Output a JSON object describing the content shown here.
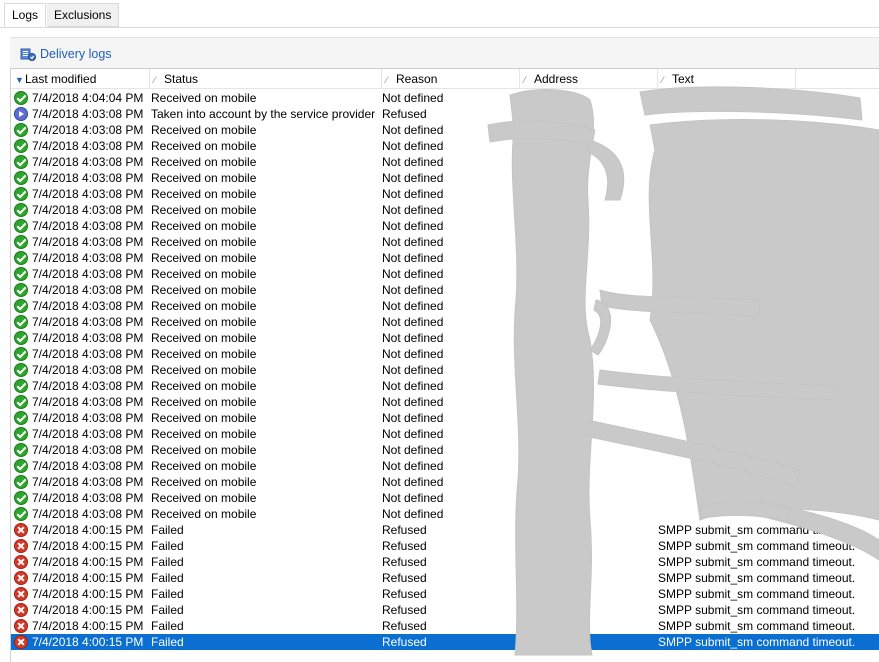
{
  "tabs": [
    {
      "label": "Logs",
      "active": true
    },
    {
      "label": "Exclusions",
      "active": false
    }
  ],
  "toolbar": {
    "link_label": "Delivery logs",
    "link_icon": "delivery-logs-icon"
  },
  "grid": {
    "columns": [
      "Last modified",
      "Status",
      "Reason",
      "Address",
      "Text"
    ],
    "sort_column": "Last modified",
    "sort_direction": "descending",
    "rows": [
      {
        "icon": "ok",
        "date": "7/4/2018 4:04:04 PM",
        "status": "Received on mobile",
        "reason": "Not defined",
        "text": ""
      },
      {
        "icon": "pending",
        "date": "7/4/2018 4:03:08 PM",
        "status": "Taken into account by the service provider",
        "reason": "Refused",
        "text": ""
      },
      {
        "icon": "ok",
        "date": "7/4/2018 4:03:08 PM",
        "status": "Received on mobile",
        "reason": "Not defined",
        "text": ""
      },
      {
        "icon": "ok",
        "date": "7/4/2018 4:03:08 PM",
        "status": "Received on mobile",
        "reason": "Not defined",
        "text": ""
      },
      {
        "icon": "ok",
        "date": "7/4/2018 4:03:08 PM",
        "status": "Received on mobile",
        "reason": "Not defined",
        "text": ""
      },
      {
        "icon": "ok",
        "date": "7/4/2018 4:03:08 PM",
        "status": "Received on mobile",
        "reason": "Not defined",
        "text": ""
      },
      {
        "icon": "ok",
        "date": "7/4/2018 4:03:08 PM",
        "status": "Received on mobile",
        "reason": "Not defined",
        "text": ""
      },
      {
        "icon": "ok",
        "date": "7/4/2018 4:03:08 PM",
        "status": "Received on mobile",
        "reason": "Not defined",
        "text": ""
      },
      {
        "icon": "ok",
        "date": "7/4/2018 4:03:08 PM",
        "status": "Received on mobile",
        "reason": "Not defined",
        "text": ""
      },
      {
        "icon": "ok",
        "date": "7/4/2018 4:03:08 PM",
        "status": "Received on mobile",
        "reason": "Not defined",
        "text": ""
      },
      {
        "icon": "ok",
        "date": "7/4/2018 4:03:08 PM",
        "status": "Received on mobile",
        "reason": "Not defined",
        "text": ""
      },
      {
        "icon": "ok",
        "date": "7/4/2018 4:03:08 PM",
        "status": "Received on mobile",
        "reason": "Not defined",
        "text": ""
      },
      {
        "icon": "ok",
        "date": "7/4/2018 4:03:08 PM",
        "status": "Received on mobile",
        "reason": "Not defined",
        "text": ""
      },
      {
        "icon": "ok",
        "date": "7/4/2018 4:03:08 PM",
        "status": "Received on mobile",
        "reason": "Not defined",
        "text": ""
      },
      {
        "icon": "ok",
        "date": "7/4/2018 4:03:08 PM",
        "status": "Received on mobile",
        "reason": "Not defined",
        "text": ""
      },
      {
        "icon": "ok",
        "date": "7/4/2018 4:03:08 PM",
        "status": "Received on mobile",
        "reason": "Not defined",
        "text": ""
      },
      {
        "icon": "ok",
        "date": "7/4/2018 4:03:08 PM",
        "status": "Received on mobile",
        "reason": "Not defined",
        "text": ""
      },
      {
        "icon": "ok",
        "date": "7/4/2018 4:03:08 PM",
        "status": "Received on mobile",
        "reason": "Not defined",
        "text": ""
      },
      {
        "icon": "ok",
        "date": "7/4/2018 4:03:08 PM",
        "status": "Received on mobile",
        "reason": "Not defined",
        "text": ""
      },
      {
        "icon": "ok",
        "date": "7/4/2018 4:03:08 PM",
        "status": "Received on mobile",
        "reason": "Not defined",
        "text": ""
      },
      {
        "icon": "ok",
        "date": "7/4/2018 4:03:08 PM",
        "status": "Received on mobile",
        "reason": "Not defined",
        "text": ""
      },
      {
        "icon": "ok",
        "date": "7/4/2018 4:03:08 PM",
        "status": "Received on mobile",
        "reason": "Not defined",
        "text": ""
      },
      {
        "icon": "ok",
        "date": "7/4/2018 4:03:08 PM",
        "status": "Received on mobile",
        "reason": "Not defined",
        "text": ""
      },
      {
        "icon": "ok",
        "date": "7/4/2018 4:03:08 PM",
        "status": "Received on mobile",
        "reason": "Not defined",
        "text": ""
      },
      {
        "icon": "ok",
        "date": "7/4/2018 4:03:08 PM",
        "status": "Received on mobile",
        "reason": "Not defined",
        "text": ""
      },
      {
        "icon": "ok",
        "date": "7/4/2018 4:03:08 PM",
        "status": "Received on mobile",
        "reason": "Not defined",
        "text": ""
      },
      {
        "icon": "ok",
        "date": "7/4/2018 4:03:08 PM",
        "status": "Received on mobile",
        "reason": "Not defined",
        "text": ""
      },
      {
        "icon": "fail",
        "date": "7/4/2018 4:00:15 PM",
        "status": "Failed",
        "reason": "Refused",
        "text": "SMPP submit_sm command timeout."
      },
      {
        "icon": "fail",
        "date": "7/4/2018 4:00:15 PM",
        "status": "Failed",
        "reason": "Refused",
        "text": "SMPP submit_sm command timeout."
      },
      {
        "icon": "fail",
        "date": "7/4/2018 4:00:15 PM",
        "status": "Failed",
        "reason": "Refused",
        "text": "SMPP submit_sm command timeout."
      },
      {
        "icon": "fail",
        "date": "7/4/2018 4:00:15 PM",
        "status": "Failed",
        "reason": "Refused",
        "text": "SMPP submit_sm command timeout."
      },
      {
        "icon": "fail",
        "date": "7/4/2018 4:00:15 PM",
        "status": "Failed",
        "reason": "Refused",
        "text": "SMPP submit_sm command timeout."
      },
      {
        "icon": "fail",
        "date": "7/4/2018 4:00:15 PM",
        "status": "Failed",
        "reason": "Refused",
        "text": "SMPP submit_sm command timeout."
      },
      {
        "icon": "fail",
        "date": "7/4/2018 4:00:15 PM",
        "status": "Failed",
        "reason": "Refused",
        "text": "SMPP submit_sm command timeout."
      },
      {
        "icon": "fail",
        "date": "7/4/2018 4:00:15 PM",
        "status": "Failed",
        "reason": "Refused",
        "text": "SMPP submit_sm command timeout.",
        "selected": true
      }
    ]
  },
  "colors": {
    "selection": "#0a6fd1",
    "ok": "#2ea52e",
    "fail": "#d33a2a",
    "pending": "#5a6fd1",
    "link": "#1e5eb8",
    "redaction": "#c9c9c9"
  }
}
